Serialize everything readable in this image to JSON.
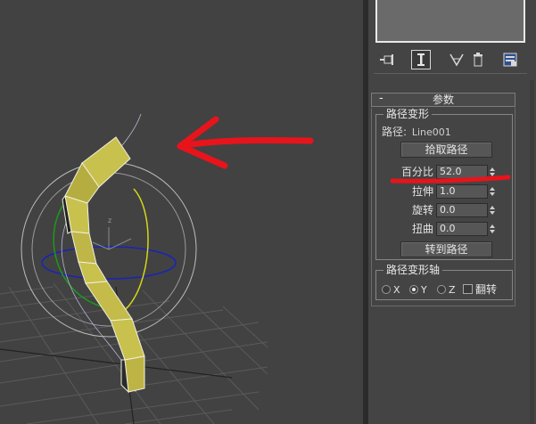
{
  "command_panel": {
    "modifier_stack_buttons": [
      {
        "icon": "pin-stack-icon",
        "pressed": false
      },
      {
        "icon": "show-end-result-icon",
        "pressed": true
      },
      {
        "icon": "make-unique-icon",
        "pressed": false
      },
      {
        "icon": "remove-modifier-icon",
        "pressed": false
      },
      {
        "icon": "configure-modifier-sets-icon",
        "pressed": false
      }
    ],
    "rollout": {
      "collapse_symbol": "-",
      "title": "参数",
      "path_deform_group": {
        "title": "路径变形",
        "path_label": "路径:",
        "path_value": "Line001",
        "pick_path_button": "拾取路径",
        "params": [
          {
            "label": "百分比",
            "value": "52.0"
          },
          {
            "label": "拉伸",
            "value": "1.0"
          },
          {
            "label": "旋转",
            "value": "0.0"
          },
          {
            "label": "扭曲",
            "value": "0.0"
          }
        ],
        "move_to_path_button": "转到路径"
      },
      "axis_group": {
        "title": "路径变形轴",
        "axes": [
          {
            "label": "X",
            "selected": false
          },
          {
            "label": "Y",
            "selected": true
          },
          {
            "label": "Z",
            "selected": false
          }
        ],
        "flip_label": "翻转",
        "flip_checked": false
      }
    }
  },
  "viewport": {
    "gizmo_axis_label": "z",
    "object_color": "#c9c14e"
  },
  "annotations": {
    "arrow_color": "#e8141b",
    "underline_color": "#e8141b"
  }
}
